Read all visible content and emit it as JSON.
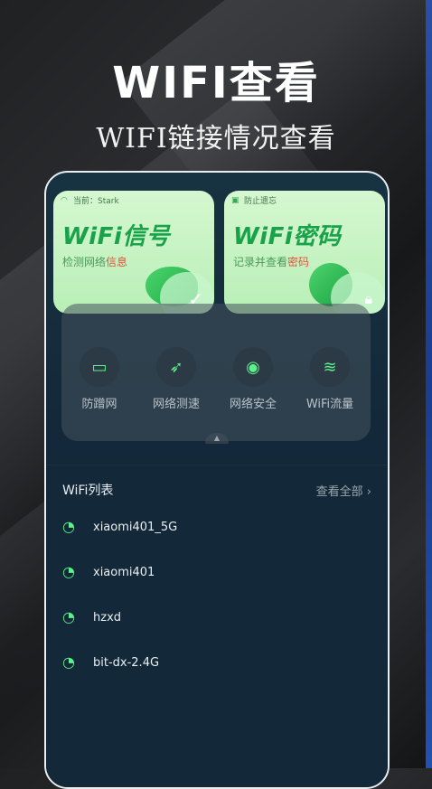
{
  "hero": {
    "title": "WIFI查看",
    "subtitle": "WIFI链接情况查看"
  },
  "cards": [
    {
      "badge": "当前：Stark",
      "badge_icon": "wifi-icon",
      "title": "WiFi信号",
      "desc_prefix": "检测网络",
      "desc_highlight": "信息",
      "decor_icon": "check-icon"
    },
    {
      "badge": "防止遗忘",
      "badge_icon": "lock-icon",
      "title": "WiFi密码",
      "desc_prefix": "记录并查看",
      "desc_highlight": "密码",
      "decor_icon": "lock-icon"
    }
  ],
  "tools": [
    {
      "label": "防蹭网",
      "icon": "router-icon"
    },
    {
      "label": "网络测速",
      "icon": "rocket-icon"
    },
    {
      "label": "网络安全",
      "icon": "shield-icon"
    },
    {
      "label": "WiFi流量",
      "icon": "wifi-icon"
    }
  ],
  "wifi_list": {
    "title": "WiFi列表",
    "view_all": "查看全部",
    "networks": [
      {
        "name": "xiaomi401_5G"
      },
      {
        "name": "xiaomi401"
      },
      {
        "name": "hzxd"
      },
      {
        "name": "bit-dx-2.4G"
      }
    ]
  },
  "colors": {
    "accent": "#18a24a",
    "highlight": "#e0533b",
    "wifi_icon": "#5ef08a"
  }
}
